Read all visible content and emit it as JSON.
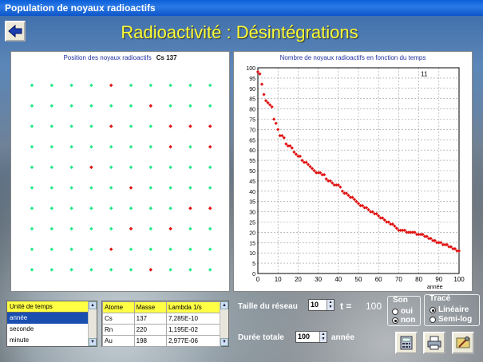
{
  "window": {
    "title": "Population de noyaux radioactifs"
  },
  "header": {
    "title": "Radioactivité : Désintégrations"
  },
  "grid_panel": {
    "title": "Position des noyaux radioactifs",
    "isotope": "Cs 137",
    "rows": 10,
    "cols": 10,
    "decayed": [
      [
        4,
        0
      ],
      [
        6,
        1
      ],
      [
        4,
        2
      ],
      [
        7,
        2
      ],
      [
        7,
        3
      ],
      [
        3,
        4
      ],
      [
        5,
        5
      ],
      [
        8,
        6
      ],
      [
        5,
        7
      ],
      [
        7,
        7
      ],
      [
        4,
        8
      ],
      [
        6,
        9
      ],
      [
        9,
        2
      ],
      [
        9,
        6
      ],
      [
        9,
        3
      ],
      [
        8,
        2
      ]
    ],
    "color_alive": "#22e888",
    "color_decayed": "#e01010"
  },
  "chart_data": {
    "type": "scatter",
    "title": "Nombre de noyaux radioactifs en fonction du temps",
    "xlabel": "année",
    "ylabel": "",
    "xlim": [
      0,
      100
    ],
    "ylim": [
      0,
      100
    ],
    "x_ticks": [
      0,
      10,
      20,
      30,
      40,
      50,
      60,
      70,
      80,
      90,
      100
    ],
    "y_ticks": [
      0,
      5,
      10,
      15,
      20,
      25,
      30,
      35,
      40,
      45,
      50,
      55,
      60,
      65,
      70,
      75,
      80,
      85,
      90,
      95,
      100
    ],
    "grid": true,
    "annotation": "11",
    "color": "#e01010",
    "x": [
      0,
      1,
      2,
      3,
      4,
      5,
      6,
      7,
      8,
      9,
      10,
      11,
      12,
      13,
      14,
      15,
      16,
      17,
      18,
      19,
      20,
      21,
      22,
      23,
      24,
      25,
      26,
      27,
      28,
      29,
      30,
      31,
      32,
      33,
      34,
      35,
      36,
      37,
      38,
      39,
      40,
      41,
      42,
      43,
      44,
      45,
      46,
      47,
      48,
      49,
      50,
      51,
      52,
      53,
      54,
      55,
      56,
      57,
      58,
      59,
      60,
      61,
      62,
      63,
      64,
      65,
      66,
      67,
      68,
      69,
      70,
      71,
      72,
      73,
      74,
      75,
      76,
      77,
      78,
      79,
      80,
      81,
      82,
      83,
      84,
      85,
      86,
      87,
      88,
      89,
      90,
      91,
      92,
      93,
      94,
      95,
      96,
      97,
      98,
      99,
      100
    ],
    "y": [
      98,
      97,
      92,
      87,
      84,
      83,
      82,
      81,
      75,
      73,
      70,
      67,
      67,
      66,
      63,
      62,
      62,
      61,
      59,
      58,
      57,
      57,
      55,
      54,
      54,
      53,
      52,
      51,
      50,
      49,
      49,
      49,
      48,
      48,
      46,
      45,
      45,
      44,
      43,
      43,
      43,
      42,
      40,
      39,
      39,
      38,
      37,
      37,
      36,
      35,
      34,
      33,
      33,
      32,
      32,
      31,
      30,
      30,
      29,
      29,
      28,
      27,
      27,
      26,
      25,
      25,
      24,
      24,
      23,
      22,
      21,
      21,
      21,
      21,
      20,
      20,
      20,
      20,
      20,
      19,
      19,
      19,
      19,
      18,
      18,
      17,
      17,
      16,
      16,
      15,
      15,
      15,
      14,
      14,
      14,
      13,
      13,
      12,
      12,
      11,
      11
    ]
  },
  "unit_table": {
    "header": "Unité de temps",
    "items": [
      "année",
      "seconde",
      "minute"
    ],
    "selected": 0
  },
  "atom_table": {
    "headers": [
      "Atome",
      "Masse",
      "Lambda 1/s"
    ],
    "rows": [
      [
        "Cs",
        "137",
        "7,285E-10"
      ],
      [
        "Rn",
        "220",
        "1,195E-02"
      ],
      [
        "Au",
        "198",
        "2,977E-06"
      ]
    ]
  },
  "controls": {
    "grid_size_label": "Taille du réseau",
    "grid_size_value": "10",
    "t_label": "t =",
    "t_value": "100",
    "duration_label": "Durée totale",
    "duration_value": "100",
    "duration_unit": "année",
    "sound": {
      "title": "Son",
      "options": [
        "oui",
        "non"
      ],
      "selected": 1
    },
    "trace": {
      "title": "Tracé",
      "options": [
        "Linéaire",
        "Semi-log"
      ],
      "selected": 0
    }
  },
  "icons": [
    "back-arrow-icon",
    "calculator-icon",
    "printer-icon",
    "tools-icon"
  ]
}
